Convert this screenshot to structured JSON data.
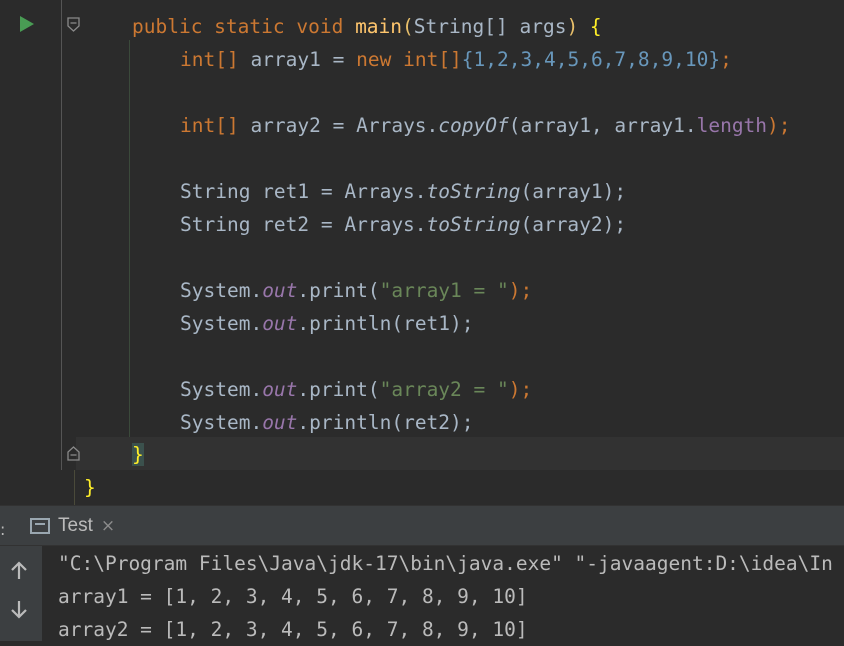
{
  "editor": {
    "code": {
      "main_sig": {
        "mods": "public static void ",
        "name": "main",
        "open": "(",
        "type": "String",
        "arr": "[] ",
        "param": "args",
        "close": ") ",
        "brace": "{"
      },
      "line_array1": {
        "type": "int[]",
        "rest": " array1 = ",
        "new": "new",
        "sp": " ",
        "type2": "int[]",
        "open": "{",
        "values": "1,2,3,4,5,6,7,8,9,10",
        "close": "}",
        "semi": ";"
      },
      "line_array2": {
        "type": "int[]",
        "rest": " array2 = Arrays.",
        "method": "copyOf",
        "args": "(array1, array1.",
        "field": "length",
        "end": ");"
      },
      "line_ret1": {
        "prefix": "String ret1 = Arrays.",
        "method": "toString",
        "args": "(array1);"
      },
      "line_ret2": {
        "prefix": "String ret2 = Arrays.",
        "method": "toString",
        "args": "(array2);"
      },
      "line_print1": {
        "sys": "System.",
        "out": "out",
        "call": ".print(",
        "str": "\"array1 = \"",
        "end": ");"
      },
      "line_println1": {
        "sys": "System.",
        "out": "out",
        "call": ".println(ret1);"
      },
      "line_print2": {
        "sys": "System.",
        "out": "out",
        "call": ".print(",
        "str": "\"array2 = \"",
        "end": ");"
      },
      "line_println2": {
        "sys": "System.",
        "out": "out",
        "call": ".println(ret2);"
      },
      "close_method": "}",
      "close_class": "}"
    }
  },
  "run_panel": {
    "tab_label": "Test",
    "tab_close": "×",
    "side_mark": ":",
    "console": [
      "\"C:\\Program Files\\Java\\jdk-17\\bin\\java.exe\" \"-javaagent:D:\\idea\\In",
      "array1 = [1, 2, 3, 4, 5, 6, 7, 8, 9, 10]",
      "array2 = [1, 2, 3, 4, 5, 6, 7, 8, 9, 10]"
    ]
  },
  "icons": [
    "run-icon",
    "fold-icon",
    "console-tab-icon",
    "close-icon",
    "arrow-up-icon",
    "arrow-down-icon"
  ],
  "colors": {
    "background": "#2b2b2b",
    "keyword": "#cc7832",
    "method_decl": "#ffc66d",
    "number": "#6897bb",
    "string": "#6a8759",
    "field": "#9876aa",
    "text": "#a9b7c6",
    "run_green": "#499c54"
  }
}
